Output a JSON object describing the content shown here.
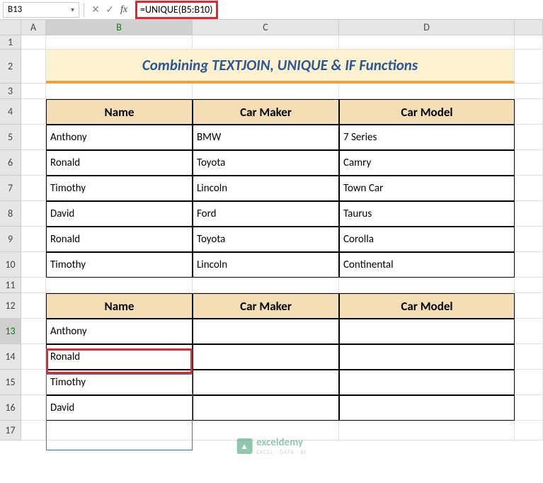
{
  "nameBox": "B13",
  "formula": "=UNIQUE(B5:B10)",
  "columns": [
    "",
    "A",
    "B",
    "C",
    "D",
    ""
  ],
  "rows": [
    "1",
    "2",
    "3",
    "4",
    "5",
    "6",
    "7",
    "8",
    "9",
    "10",
    "11",
    "12",
    "13",
    "14",
    "15",
    "16",
    "17"
  ],
  "title": "Combining TEXTJOIN, UNIQUE & IF Functions",
  "headers": {
    "name": "Name",
    "maker": "Car Maker",
    "model": "Car Model"
  },
  "table1": [
    {
      "name": "Anthony",
      "maker": "BMW",
      "model": "7 Series"
    },
    {
      "name": "Ronald",
      "maker": "Toyota",
      "model": "Camry"
    },
    {
      "name": "Timothy",
      "maker": "Lincoln",
      "model": "Town Car"
    },
    {
      "name": "David",
      "maker": "Ford",
      "model": "Taurus"
    },
    {
      "name": "Ronald",
      "maker": "Toyota",
      "model": "Corolla"
    },
    {
      "name": "Timothy",
      "maker": "Lincoln",
      "model": "Continental"
    }
  ],
  "table2": [
    {
      "name": "Anthony",
      "maker": "",
      "model": ""
    },
    {
      "name": "Ronald",
      "maker": "",
      "model": ""
    },
    {
      "name": "Timothy",
      "maker": "",
      "model": ""
    },
    {
      "name": "David",
      "maker": "",
      "model": ""
    }
  ],
  "watermark": {
    "brand": "exceldemy",
    "sub": "EXCEL · DATA · BI"
  }
}
